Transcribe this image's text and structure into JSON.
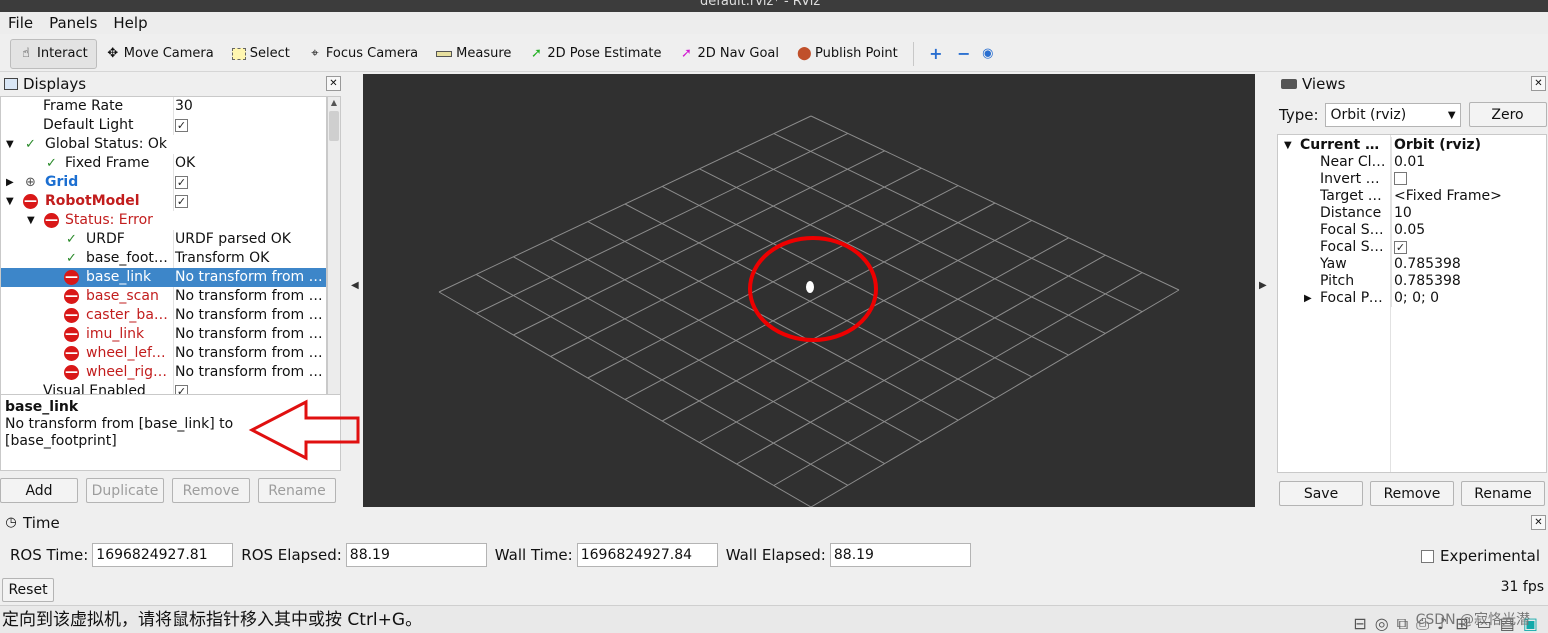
{
  "window": {
    "title": "default.rviz* - RViz"
  },
  "menu": [
    "File",
    "Panels",
    "Help"
  ],
  "toolbar": {
    "interact": "Interact",
    "move_camera": "Move Camera",
    "select": "Select",
    "focus_camera": "Focus Camera",
    "measure": "Measure",
    "pose_estimate": "2D Pose Estimate",
    "nav_goal": "2D Nav Goal",
    "publish_point": "Publish Point"
  },
  "displays": {
    "title": "Displays",
    "rows": [
      {
        "name": "Frame Rate",
        "value": "30"
      },
      {
        "name": "Default Light",
        "value": ""
      },
      {
        "name": "Global Status: Ok",
        "value": ""
      },
      {
        "name": "Fixed Frame",
        "value": "OK"
      },
      {
        "name": "Grid",
        "value": ""
      },
      {
        "name": "RobotModel",
        "value": ""
      },
      {
        "name": "Status: Error",
        "value": ""
      },
      {
        "name": "URDF",
        "value": "URDF parsed OK"
      },
      {
        "name": "base_footprint",
        "value": "Transform OK"
      },
      {
        "name": "base_link",
        "value": "No transform from [base_link] to [base_footprint]"
      },
      {
        "name": "base_scan",
        "value": "No transform from [base_scan] to [base_footprint]"
      },
      {
        "name": "caster_back_link",
        "value": "No transform from [caster_back_link] to [base_footprint]"
      },
      {
        "name": "imu_link",
        "value": "No transform from [imu_link] to [base_footprint]"
      },
      {
        "name": "wheel_left_link",
        "value": "No transform from [wheel_left_link] to [base_footprint]"
      },
      {
        "name": "wheel_right_link",
        "value": "No transform from [wheel_right_link] to [base_footprint]"
      },
      {
        "name": "Visual Enabled",
        "value": ""
      }
    ],
    "desc_title": "base_link",
    "desc_text": "No transform from [base_link] to [base_footprint]",
    "buttons": {
      "add": "Add",
      "duplicate": "Duplicate",
      "remove": "Remove",
      "rename": "Rename"
    }
  },
  "views": {
    "title": "Views",
    "type_label": "Type:",
    "type_value": "Orbit (rviz)",
    "zero": "Zero",
    "rows": [
      {
        "name": "Current View",
        "value": "Orbit (rviz)"
      },
      {
        "name": "Near Clip Distance",
        "value": "0.01"
      },
      {
        "name": "Invert Z Axis",
        "value": ""
      },
      {
        "name": "Target Frame",
        "value": "<Fixed Frame>"
      },
      {
        "name": "Distance",
        "value": "10"
      },
      {
        "name": "Focal Shape Size",
        "value": "0.05"
      },
      {
        "name": "Focal Shape Fixed Size",
        "value": ""
      },
      {
        "name": "Yaw",
        "value": "0.785398"
      },
      {
        "name": "Pitch",
        "value": "0.785398"
      },
      {
        "name": "Focal Point",
        "value": "0; 0; 0"
      }
    ],
    "buttons": {
      "save": "Save",
      "remove": "Remove",
      "rename": "Rename"
    }
  },
  "time": {
    "title": "Time",
    "ros_time_label": "ROS Time:",
    "ros_time": "1696824927.81",
    "ros_elapsed_label": "ROS Elapsed:",
    "ros_elapsed": "88.19",
    "wall_time_label": "Wall Time:",
    "wall_time": "1696824927.84",
    "wall_elapsed_label": "Wall Elapsed:",
    "wall_elapsed": "88.19",
    "experimental": "Experimental",
    "reset": "Reset",
    "fps": "31 fps"
  },
  "statusbar": {
    "text": "定向到该虚拟机，请将鼠标指针移入其中或按 Ctrl+G。",
    "watermark": "CSDN @寂恪光潜"
  }
}
